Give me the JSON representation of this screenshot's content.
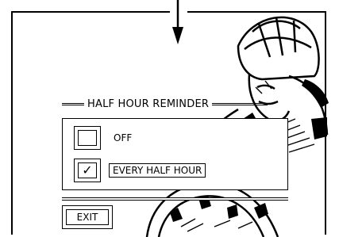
{
  "dialog": {
    "title": "HALF HOUR REMINDER",
    "options": [
      {
        "label": "OFF",
        "checked": false,
        "check_mark": ""
      },
      {
        "label": "EVERY HALF HOUR",
        "checked": true,
        "check_mark": "✓"
      }
    ],
    "exit_label": "EXIT"
  },
  "illustration": "cyclist-illustration",
  "colors": {
    "foreground": "#000000",
    "background": "#ffffff"
  }
}
